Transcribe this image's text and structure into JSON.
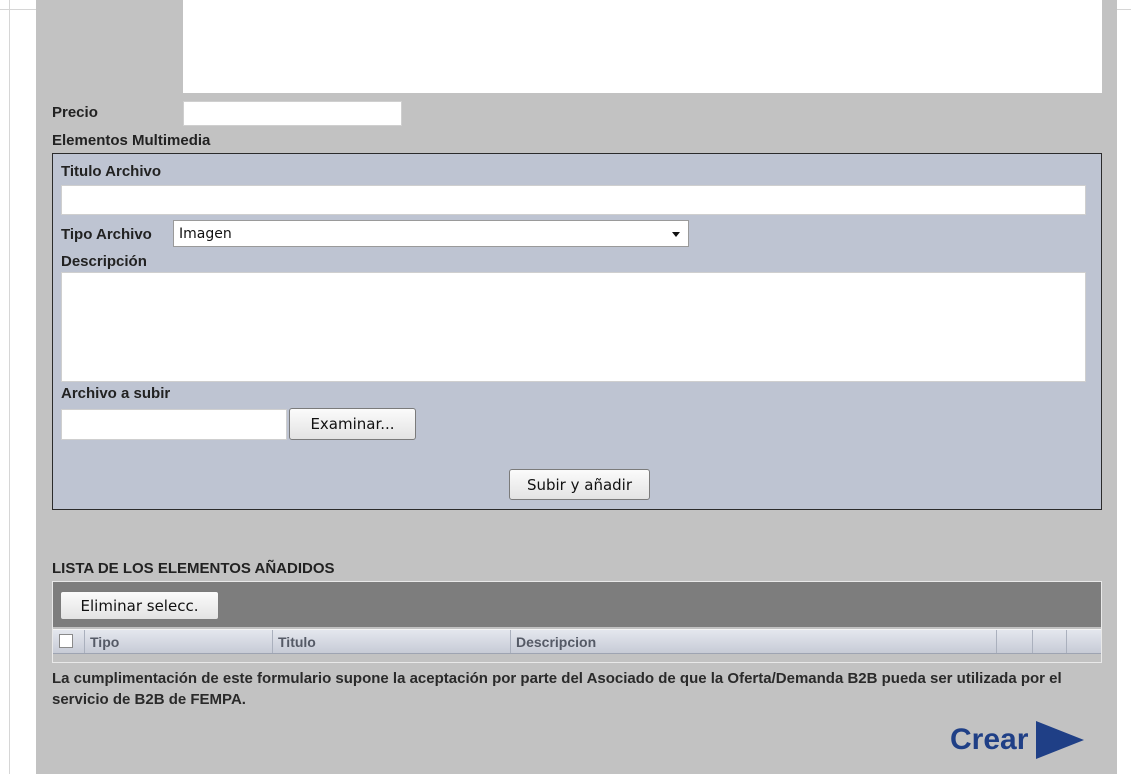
{
  "form": {
    "precio_label": "Precio",
    "precio_value": "",
    "multimedia_label": "Elementos Multimedia"
  },
  "multimedia": {
    "titulo_label": "Titulo Archivo",
    "titulo_value": "",
    "tipo_label": "Tipo Archivo",
    "tipo_selected": "Imagen",
    "descripcion_label": "Descripción",
    "archivo_label": "Archivo a subir",
    "examinar_button": "Examinar...",
    "subir_button": "Subir y añadir"
  },
  "list": {
    "title": "LISTA DE LOS ELEMENTOS AÑADIDOS",
    "eliminar_button": "Eliminar selecc.",
    "columns": [
      "Tipo",
      "Titulo",
      "Descripcion"
    ]
  },
  "footer": {
    "note": "La cumplimentación de este formulario supone la aceptación por parte del Asociado de que la Oferta/Demanda B2B pueda ser utilizada por el servicio de B2B de FEMPA.",
    "crear_label": "Crear"
  },
  "colors": {
    "panel": "#c2c2c2",
    "multimedia_box": "#bec4d2",
    "crear": "#1f3f86"
  },
  "icons": [
    "dropdown-caret-icon",
    "play-arrow-icon",
    "checkbox-icon"
  ]
}
